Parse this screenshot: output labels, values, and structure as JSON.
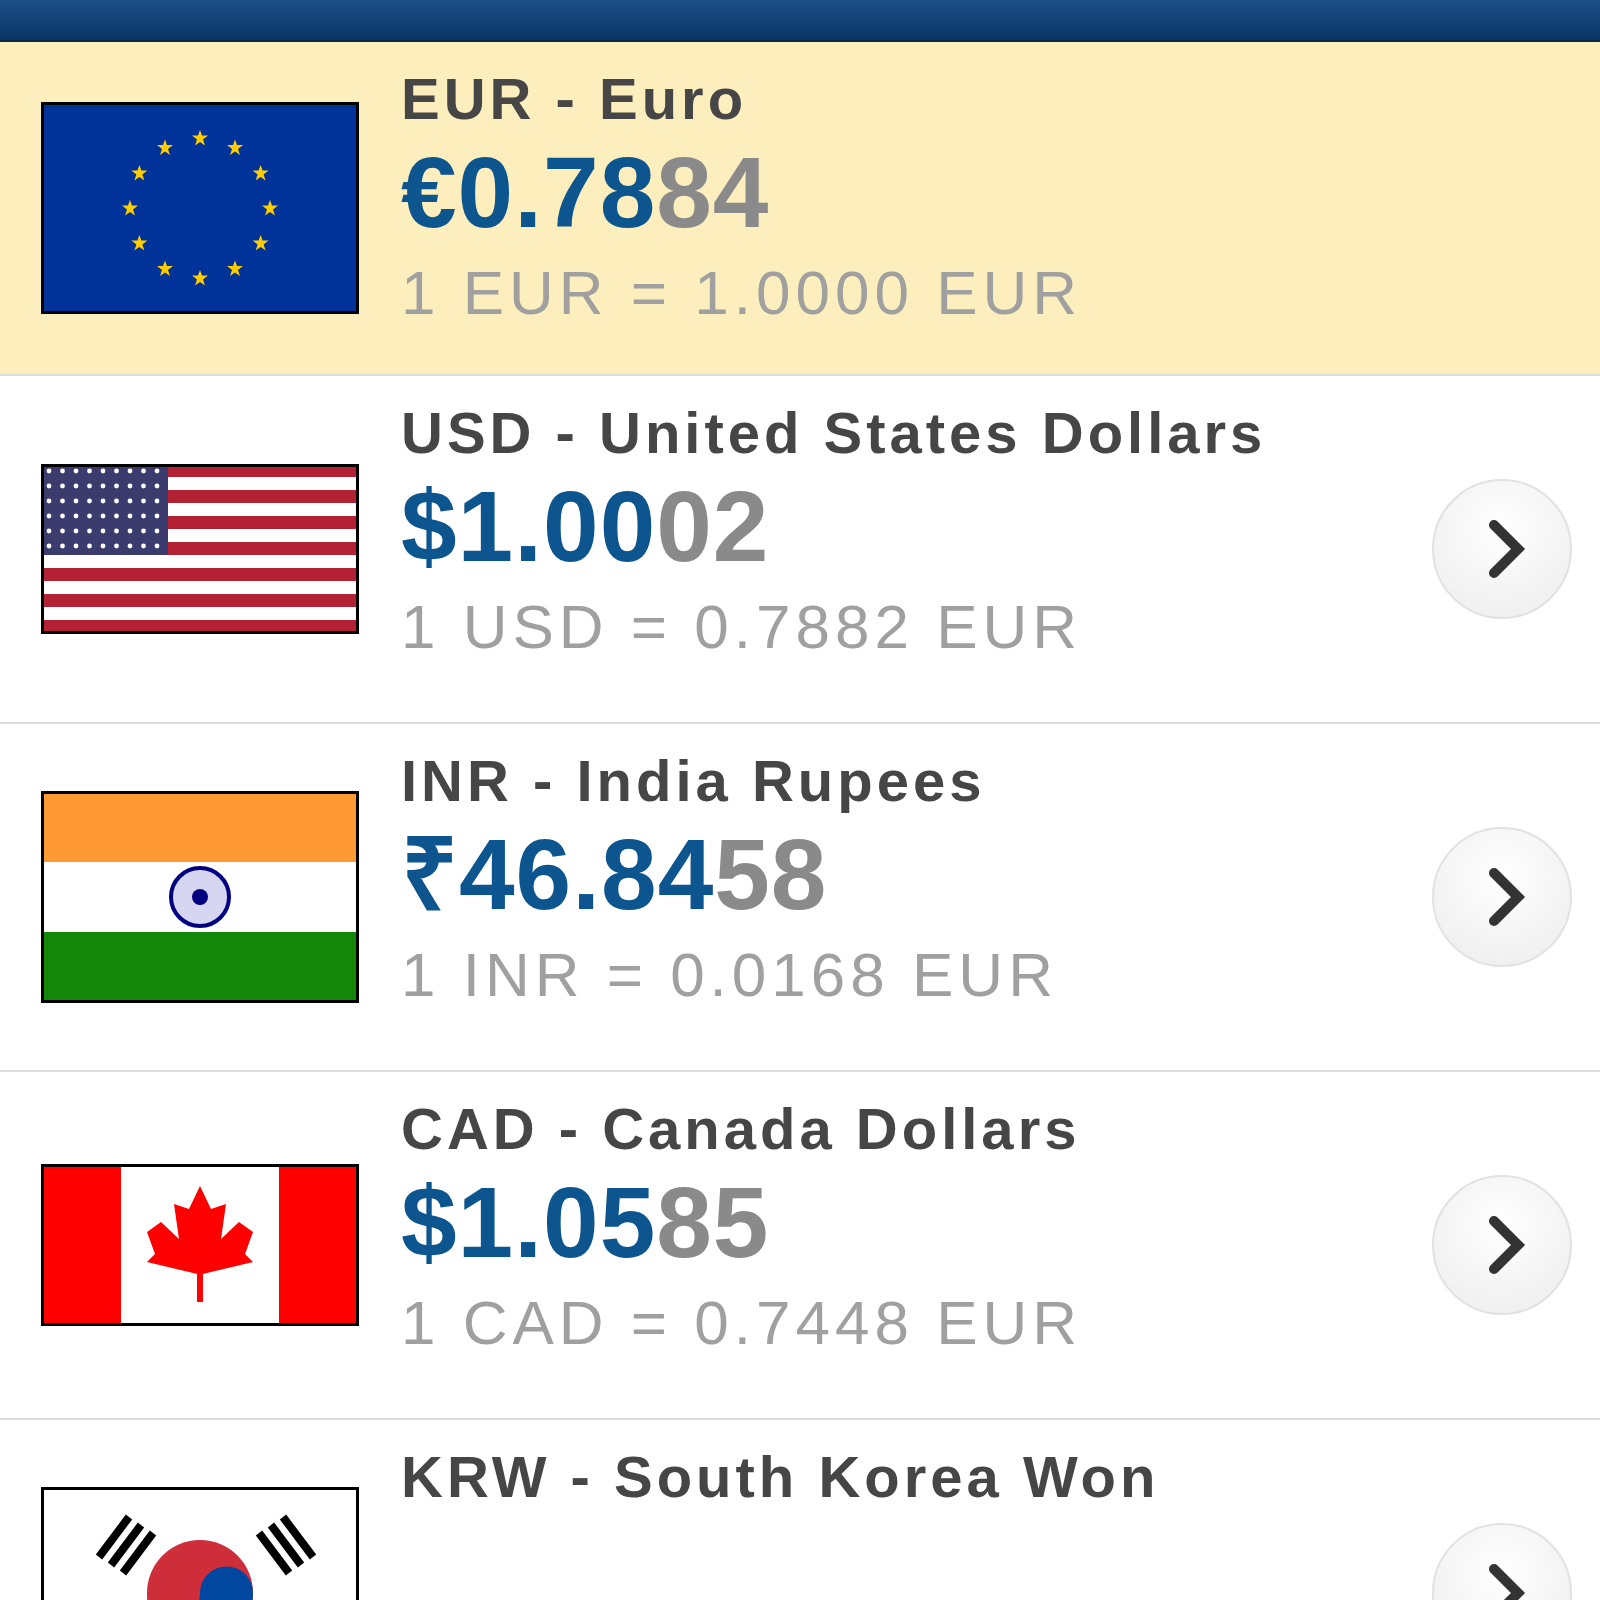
{
  "currencies": [
    {
      "kind": "eu",
      "name": "EUR - Euro",
      "price_main": "€0.78",
      "price_tail": "84",
      "rate": "1 EUR = 1.0000 EUR",
      "selected": true
    },
    {
      "kind": "us",
      "name": "USD - United States Dollars",
      "price_main": "$1.00",
      "price_tail": "02",
      "rate": "1 USD = 0.7882 EUR",
      "selected": false
    },
    {
      "kind": "in",
      "name": "INR - India Rupees",
      "price_main": "₹46.84",
      "price_tail": "58",
      "rate": "1 INR = 0.0168 EUR",
      "selected": false
    },
    {
      "kind": "ca",
      "name": "CAD - Canada Dollars",
      "price_main": "$1.05",
      "price_tail": "85",
      "rate": "1 CAD = 0.7448 EUR",
      "selected": false
    },
    {
      "kind": "kr",
      "name": "KRW - South Korea Won",
      "selected": false
    }
  ]
}
